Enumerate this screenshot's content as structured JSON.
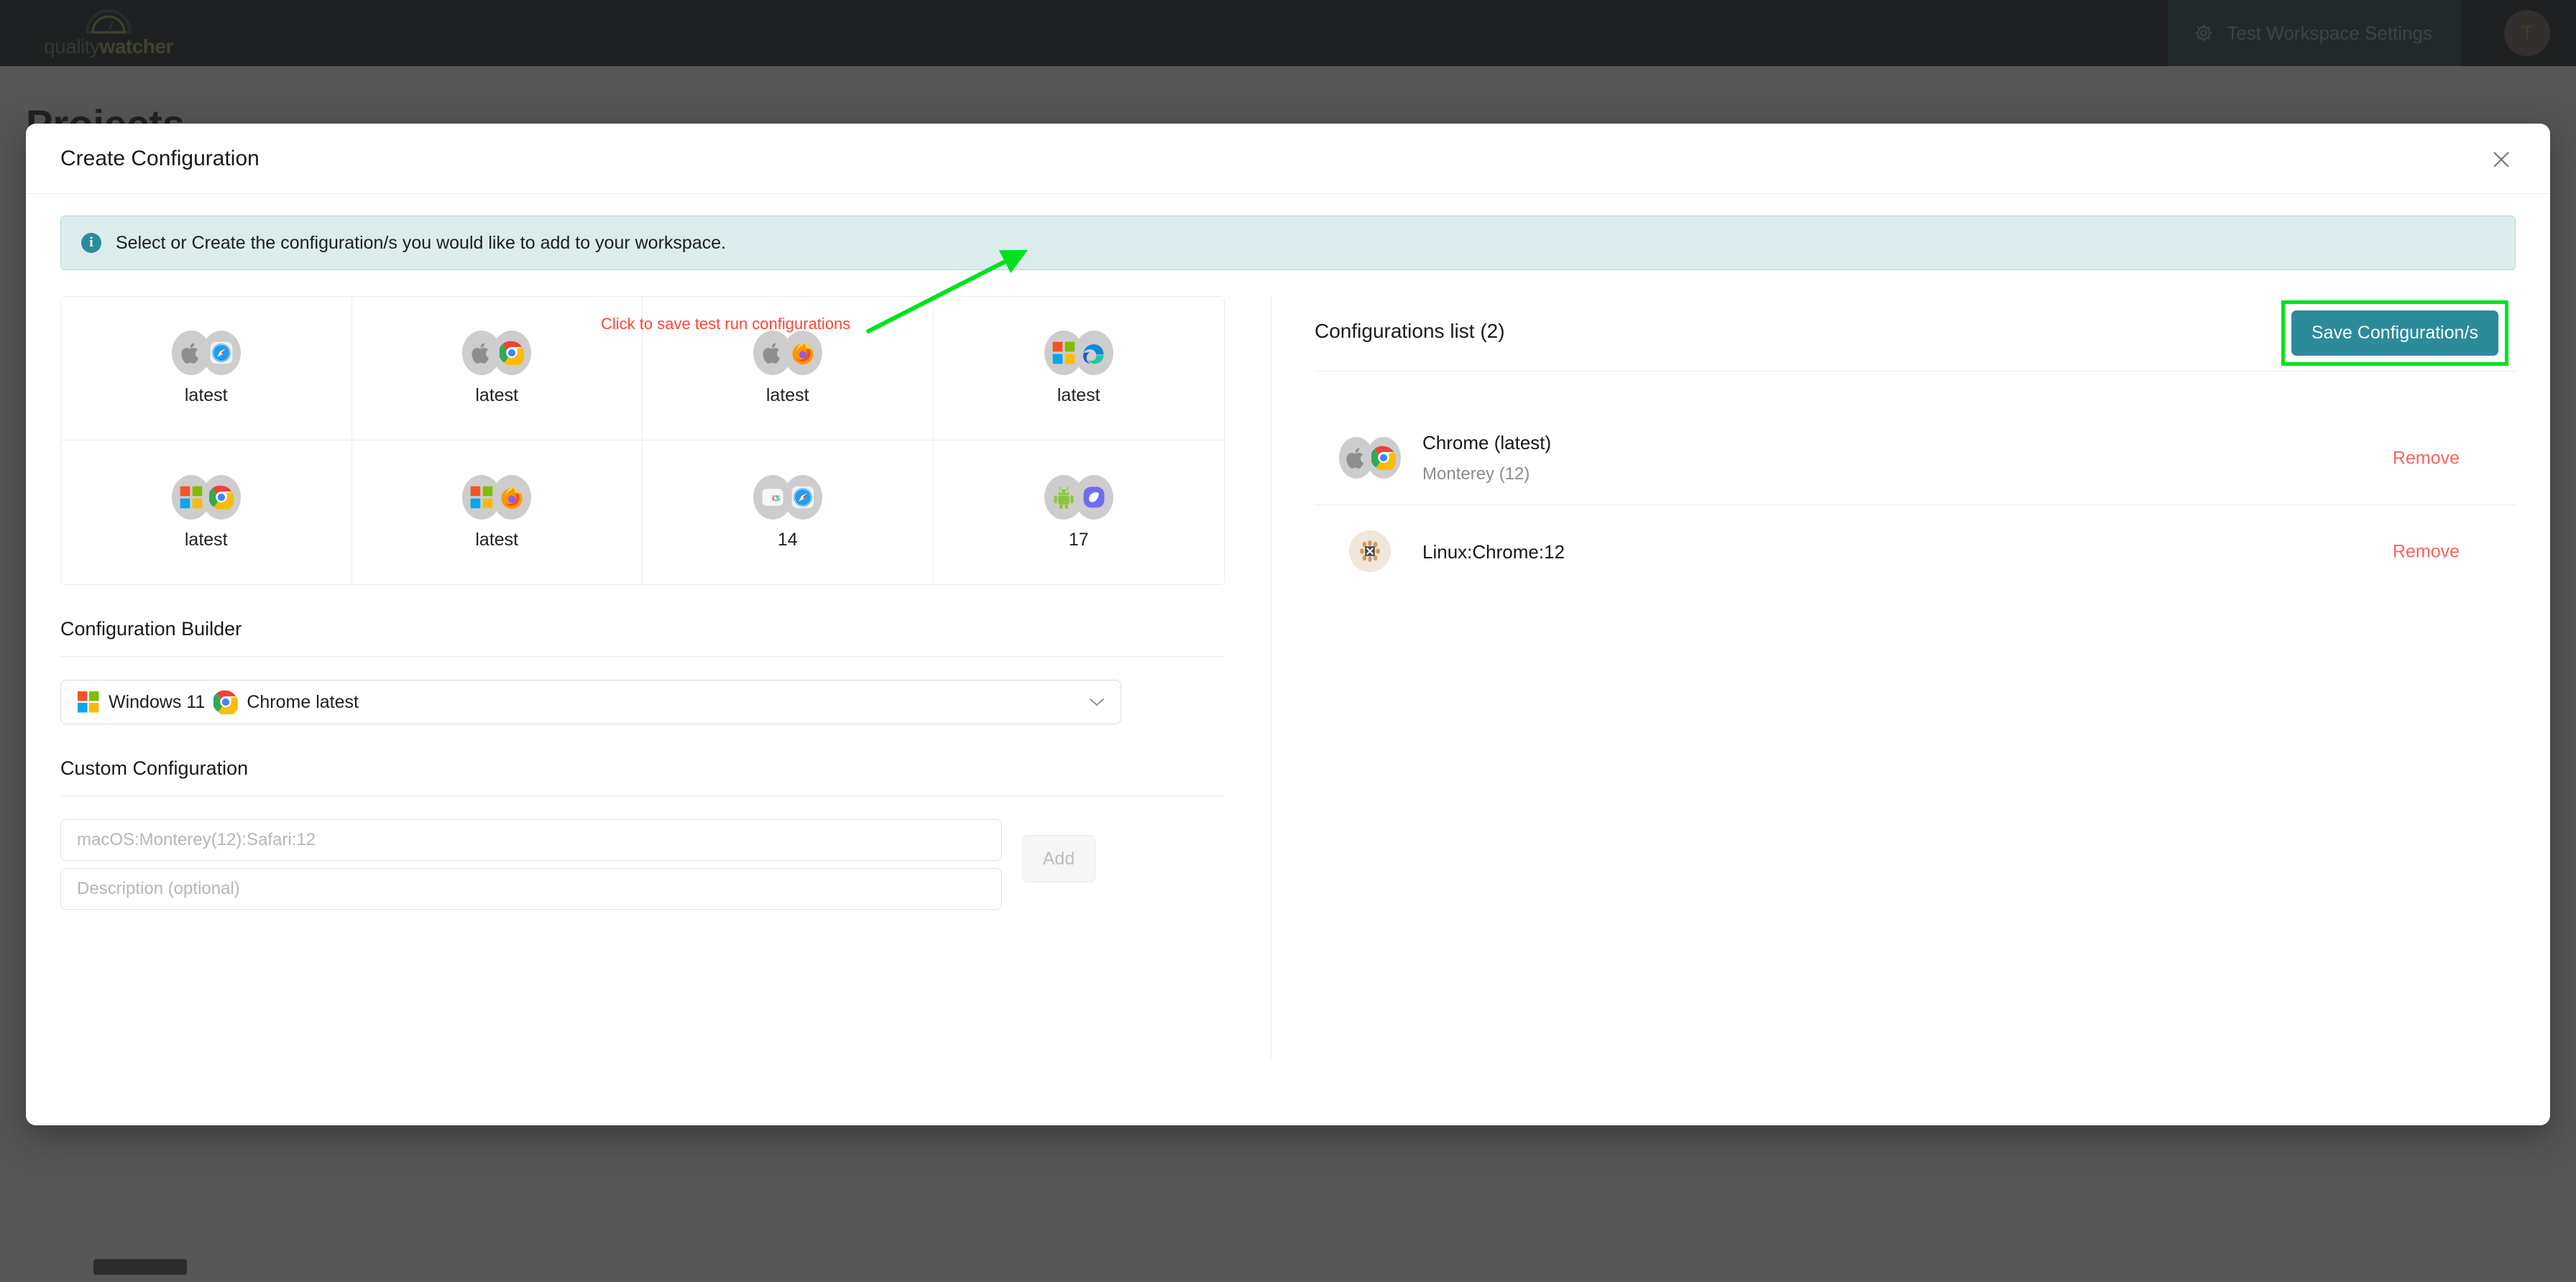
{
  "topbar": {
    "logo_text_primary": "quality",
    "logo_text_secondary": "watcher",
    "logo_icon": "gauge-icon",
    "workspace_settings_label": "Test Workspace Settings",
    "workspace_settings_icon": "gear-icon",
    "avatar_initial": "T"
  },
  "page": {
    "heading": "Projects"
  },
  "modal": {
    "title": "Create Configuration",
    "close_icon": "close-icon",
    "info_icon": "info-icon",
    "info_text": "Select or Create the configuration/s you would like to add to your workspace."
  },
  "tiles": [
    {
      "os_icon": "apple-icon",
      "browser_icon": "safari-icon",
      "label": "latest"
    },
    {
      "os_icon": "apple-icon",
      "browser_icon": "chrome-icon",
      "label": "latest"
    },
    {
      "os_icon": "apple-icon",
      "browser_icon": "firefox-icon",
      "label": "latest"
    },
    {
      "os_icon": "windows-icon",
      "browser_icon": "edge-icon",
      "label": "latest"
    },
    {
      "os_icon": "windows-icon",
      "browser_icon": "chrome-icon",
      "label": "latest"
    },
    {
      "os_icon": "windows-icon",
      "browser_icon": "firefox-icon",
      "label": "latest"
    },
    {
      "os_icon": "ios-icon",
      "browser_icon": "safari-icon",
      "label": "14"
    },
    {
      "os_icon": "android-icon",
      "browser_icon": "samsung-internet-icon",
      "label": "17"
    }
  ],
  "builder": {
    "section_title": "Configuration Builder",
    "selected_value": "Windows 11  Chrome latest",
    "selected_os": "Windows 11",
    "selected_browser": "Chrome latest",
    "os_icon": "windows-icon",
    "browser_icon": "chrome-icon",
    "chevron_icon": "chevron-down-icon"
  },
  "custom": {
    "section_title": "Custom Configuration",
    "config_placeholder": "macOS:Monterey(12):Safari:12",
    "config_value": "",
    "description_placeholder": "Description (optional)",
    "description_value": "",
    "add_label": "Add"
  },
  "configs_panel": {
    "title": "Configurations list (2)",
    "save_label": "Save Configuration/s",
    "save_color": "#2c8b9b",
    "highlight_color": "#00e21e",
    "annotation_text": "Click to save test run configurations",
    "annotation_color": "#ff4433",
    "remove_label": "Remove",
    "items": [
      {
        "name": "Chrome (latest)",
        "sub": "Monterey (12)",
        "os_icon": "apple-icon",
        "browser_icon": "chrome-icon",
        "icon_style": "pair",
        "remove_label": "Remove"
      },
      {
        "name": "Linux:Chrome:12",
        "sub": "",
        "os_icon": "broken-image-icon",
        "browser_icon": "",
        "icon_style": "single",
        "remove_label": "Remove"
      }
    ]
  }
}
